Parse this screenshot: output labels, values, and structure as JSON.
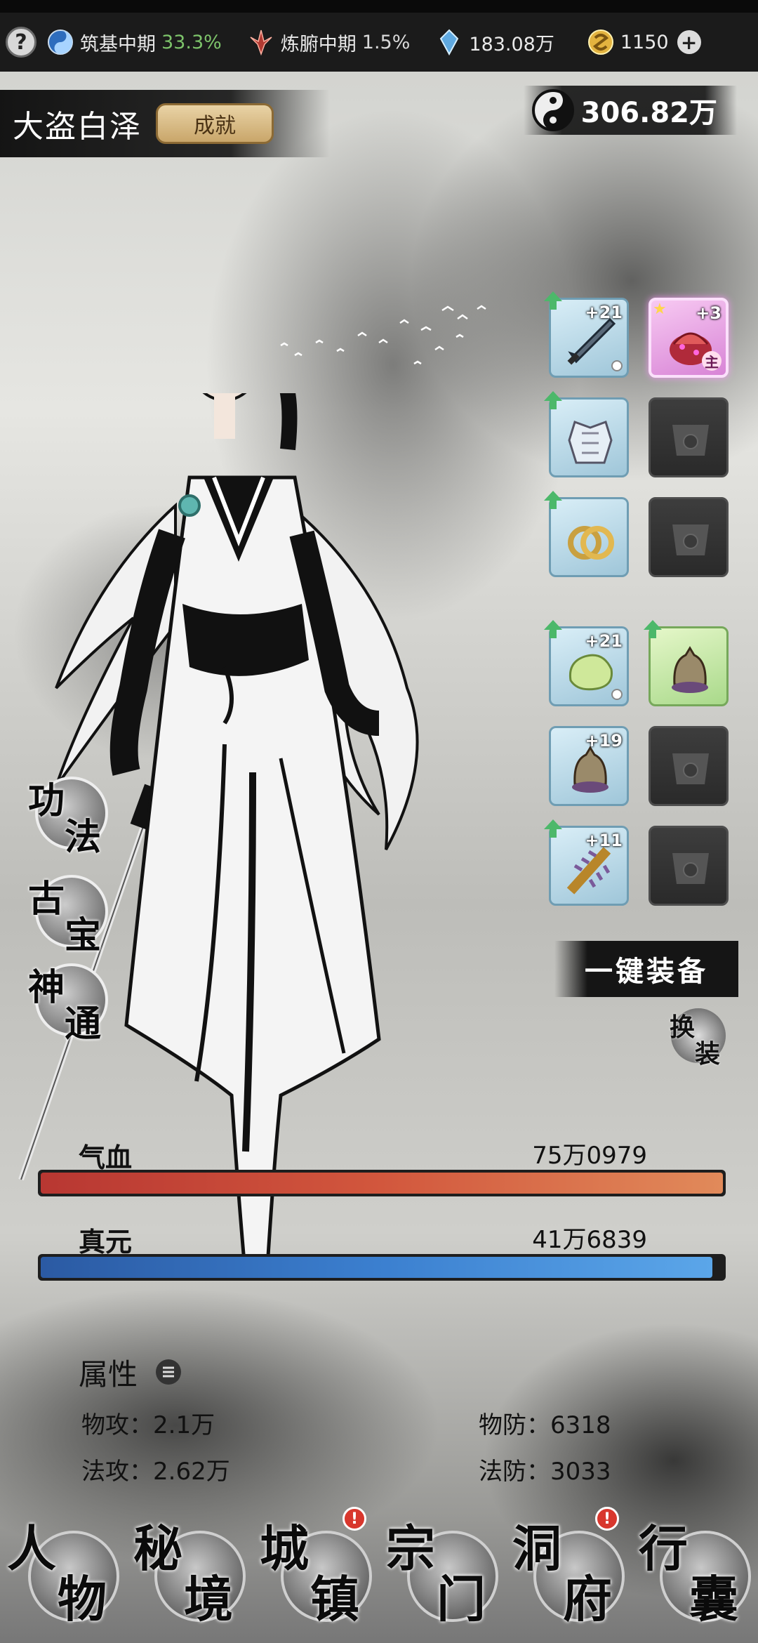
{
  "top_bar": {
    "help_label": "?",
    "cultivation": {
      "label": "筑基中期",
      "percent": "33.3%"
    },
    "body_refine": {
      "label": "炼腑中期",
      "percent": "1.5%"
    },
    "spirit_crystal": {
      "value": "183.08万"
    },
    "gold": {
      "value": "1150"
    },
    "plus_label": "+"
  },
  "header": {
    "character_name": "大盗白泽",
    "achievement_label": "成就",
    "spirit_stones": "306.82万"
  },
  "equipment": [
    {
      "slot": "weapon",
      "level": "+21",
      "icon": "sword-icon",
      "state": "filled",
      "upgrade": true
    },
    {
      "slot": "treasure",
      "level": "+3",
      "icon": "treasure-pot-icon",
      "state": "pink",
      "upgrade": false,
      "main_tag": "主"
    },
    {
      "slot": "armor",
      "level": "",
      "icon": "armor-icon",
      "state": "filled",
      "upgrade": true
    },
    {
      "slot": "empty-1",
      "level": "",
      "icon": "empty-slot-icon",
      "state": "empty",
      "upgrade": false
    },
    {
      "slot": "ring",
      "level": "",
      "icon": "rings-icon",
      "state": "filled",
      "upgrade": true
    },
    {
      "slot": "empty-2",
      "level": "",
      "icon": "empty-slot-icon",
      "state": "empty",
      "upgrade": false
    },
    {
      "slot": "jade",
      "level": "+21",
      "icon": "jade-icon",
      "state": "filled",
      "upgrade": true
    },
    {
      "slot": "bell-green",
      "level": "",
      "icon": "bell-icon",
      "state": "green",
      "upgrade": true
    },
    {
      "slot": "bell",
      "level": "+19",
      "icon": "bell-icon",
      "state": "filled",
      "upgrade": false
    },
    {
      "slot": "empty-3",
      "level": "",
      "icon": "empty-slot-icon",
      "state": "empty",
      "upgrade": false
    },
    {
      "slot": "mace",
      "level": "+11",
      "icon": "mace-icon",
      "state": "filled",
      "upgrade": true
    },
    {
      "slot": "empty-4",
      "level": "",
      "icon": "empty-slot-icon",
      "state": "empty",
      "upgrade": false
    }
  ],
  "side_buttons": [
    {
      "c1": "功",
      "c2": "法"
    },
    {
      "c1": "古",
      "c2": "宝"
    },
    {
      "c1": "神",
      "c2": "通"
    }
  ],
  "one_key_equip": "一键装备",
  "swap": {
    "c1": "换",
    "c2": "装"
  },
  "hp": {
    "label": "气血",
    "value": "75万0979",
    "fill": 1.0
  },
  "mp": {
    "label": "真元",
    "value": "41万6839",
    "fill": 0.985
  },
  "attributes": {
    "title": "属性",
    "phys_atk": "物攻：2.1万",
    "phys_def": "物防：6318",
    "magic_atk": "法攻：2.62万",
    "magic_def": "法防：3033"
  },
  "bottom_nav": [
    {
      "c1": "人",
      "c2": "物",
      "badge": false
    },
    {
      "c1": "秘",
      "c2": "境",
      "badge": false
    },
    {
      "c1": "城",
      "c2": "镇",
      "badge": true
    },
    {
      "c1": "宗",
      "c2": "门",
      "badge": false
    },
    {
      "c1": "洞",
      "c2": "府",
      "badge": true
    },
    {
      "c1": "行",
      "c2": "囊",
      "badge": false
    }
  ],
  "colors": {
    "hp_bar": "#c8473a",
    "mp_bar": "#3b7fcf",
    "green_percent": "#7dc36a",
    "badge_red": "#d8372d"
  }
}
